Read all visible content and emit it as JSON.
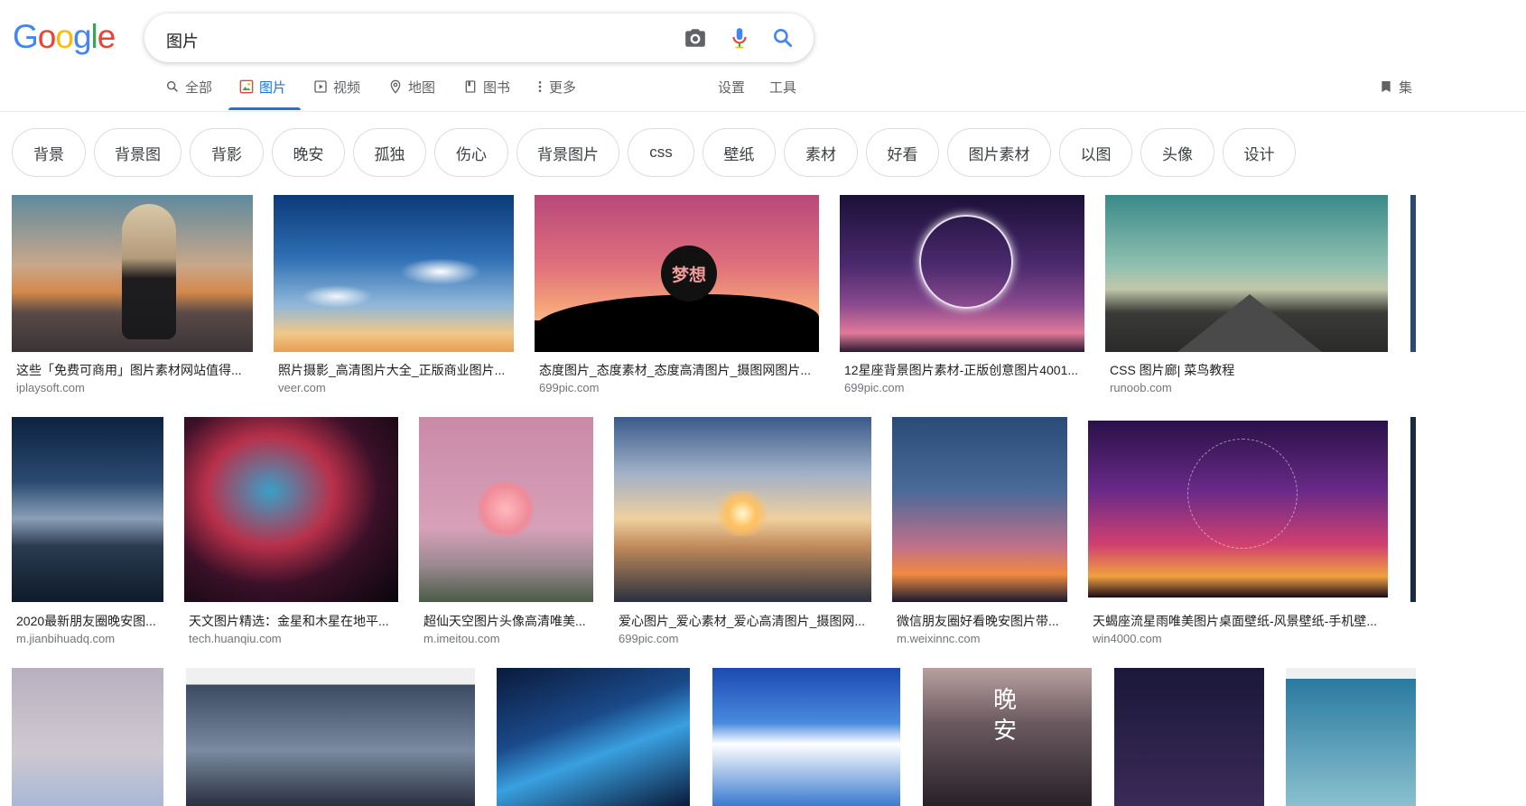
{
  "logo": "Google",
  "search": {
    "query": "图片"
  },
  "tabs": [
    {
      "label": "全部"
    },
    {
      "label": "图片"
    },
    {
      "label": "视频"
    },
    {
      "label": "地图"
    },
    {
      "label": "图书"
    },
    {
      "label": "更多"
    }
  ],
  "settings_label": "设置",
  "tools_label": "工具",
  "collections_label": "集",
  "chips": [
    "背景",
    "背景图",
    "背影",
    "晚安",
    "孤独",
    "伤心",
    "背景图片",
    "css",
    "壁纸",
    "素材",
    "好看",
    "图片素材",
    "以图",
    "头像",
    "设计"
  ],
  "results": {
    "row1": [
      {
        "caption": "这些「免费可商用」图片素材网站值得...",
        "source": "iplaysoft.com"
      },
      {
        "caption": "照片摄影_高清图片大全_正版商业图片...",
        "source": "veer.com"
      },
      {
        "caption": "态度图片_态度素材_态度高清图片_摄图网图片...",
        "source": "699pic.com",
        "overlay": "梦想"
      },
      {
        "caption": "12星座背景图片素材-正版创意图片4001...",
        "source": "699pic.com"
      },
      {
        "caption": "CSS 图片廊| 菜鸟教程",
        "source": "runoob.com"
      }
    ],
    "row2": [
      {
        "caption": "2020最新朋友圈晚安图...",
        "source": "m.jianbihuadq.com"
      },
      {
        "caption": "天文图片精选：金星和木星在地平...",
        "source": "tech.huanqiu.com"
      },
      {
        "caption": "超仙天空图片头像高清唯美...",
        "source": "m.imeitou.com"
      },
      {
        "caption": "爱心图片_爱心素材_爱心高清图片_摄图网...",
        "source": "699pic.com"
      },
      {
        "caption": "微信朋友圈好看晚安图片带...",
        "source": "m.weixinnc.com"
      },
      {
        "caption": "天蝎座流星雨唯美图片桌面壁纸-风景壁纸-手机壁...",
        "source": "win4000.com"
      }
    ],
    "row3_overlay": "晚安"
  },
  "colors": {
    "accent": "#1a73e8"
  }
}
